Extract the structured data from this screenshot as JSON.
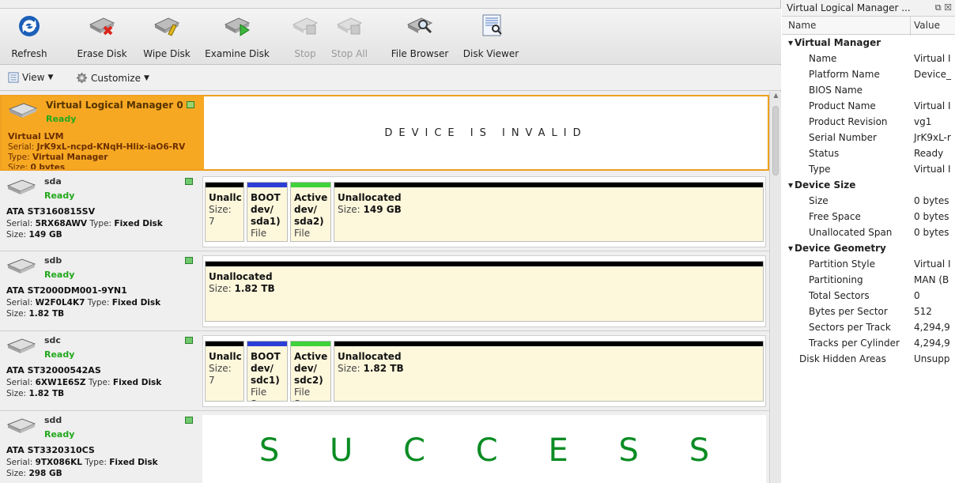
{
  "toolbar": {
    "buttons": [
      {
        "label": "Refresh",
        "enabled": true,
        "icon": "refresh-icon"
      },
      {
        "label": "Erase Disk",
        "enabled": true,
        "icon": "erase-disk-icon"
      },
      {
        "label": "Wipe Disk",
        "enabled": true,
        "icon": "wipe-disk-icon"
      },
      {
        "label": "Examine Disk",
        "enabled": true,
        "icon": "examine-disk-icon"
      },
      {
        "label": "Stop",
        "enabled": false,
        "icon": "stop-icon"
      },
      {
        "label": "Stop All",
        "enabled": false,
        "icon": "stop-all-icon"
      },
      {
        "label": "File Browser",
        "enabled": true,
        "icon": "file-browser-icon"
      },
      {
        "label": "Disk Viewer",
        "enabled": true,
        "icon": "disk-viewer-icon"
      }
    ]
  },
  "viewbar": {
    "view_label": "View",
    "customize_label": "Customize"
  },
  "disks": [
    {
      "name": "Virtual Logical Manager 0",
      "status": "Ready",
      "model": "Virtual LVM",
      "serial_label": "Serial:",
      "serial": "JrK9xL-ncpd-KNqH-Hlix-iaO6-RV",
      "type_label": "Type:",
      "type": "Virtual Manager",
      "size_label": "Size:",
      "size": "0 bytes",
      "message": "DEVICE IS INVALID"
    },
    {
      "name": "sda",
      "status": "Ready",
      "model": "ATA ST3160815SV",
      "serial_label": "Serial:",
      "serial": "5RX68AWV",
      "type_label": "Type:",
      "type": "Fixed Disk",
      "size_label": "Size:",
      "size": "149 GB",
      "partitions": [
        {
          "title": "Unallc",
          "sub": "Size: 7",
          "color": "#000000"
        },
        {
          "title": "BOOT",
          "l2": "dev/",
          "l3": "sda1)",
          "l4": "File Sys",
          "color": "#2c3ed6"
        },
        {
          "title": "Active",
          "l2": "dev/",
          "l3": "sda2)",
          "l4": "File Sys",
          "color": "#3fd23a"
        },
        {
          "title": "Unallocated",
          "sub_label": "Size:",
          "sub_value": "149 GB",
          "color": "#000000"
        }
      ]
    },
    {
      "name": "sdb",
      "status": "Ready",
      "model": "ATA ST2000DM001-9YN1",
      "serial_label": "Serial:",
      "serial": "W2F0L4K7",
      "type_label": "Type:",
      "type": "Fixed Disk",
      "size_label": "Size:",
      "size": "1.82 TB",
      "partitions": [
        {
          "title": "Unallocated",
          "sub_label": "Size:",
          "sub_value": "1.82 TB",
          "color": "#000000"
        }
      ]
    },
    {
      "name": "sdc",
      "status": "Ready",
      "model": "ATA ST32000542AS",
      "serial_label": "Serial:",
      "serial": "6XW1E6SZ",
      "type_label": "Type:",
      "type": "Fixed Disk",
      "size_label": "Size:",
      "size": "1.82 TB",
      "partitions": [
        {
          "title": "Unallc",
          "sub": "Size: 7",
          "color": "#000000"
        },
        {
          "title": "BOOT",
          "l2": "dev/",
          "l3": "sdc1)",
          "l4": "File Sys",
          "color": "#2c3ed6"
        },
        {
          "title": "Active",
          "l2": "dev/",
          "l3": "sdc2)",
          "l4": "File Sys",
          "color": "#3fd23a"
        },
        {
          "title": "Unallocated",
          "sub_label": "Size:",
          "sub_value": "1.82 TB",
          "color": "#000000"
        }
      ]
    },
    {
      "name": "sdd",
      "status": "Ready",
      "model": "ATA ST3320310CS",
      "serial_label": "Serial:",
      "serial": "9TX086KL",
      "type_label": "Type:",
      "type": "Fixed Disk",
      "size_label": "Size:",
      "size": "298 GB",
      "message_letters": [
        "S",
        "U",
        "C",
        "C",
        "E",
        "S",
        "S"
      ]
    }
  ],
  "properties": {
    "title": "Virtual Logical Manager ...",
    "col_name": "Name",
    "col_value": "Value",
    "rows": [
      {
        "group": true,
        "name": "Virtual Manager"
      },
      {
        "name": "Name",
        "value": "Virtual I"
      },
      {
        "name": "Platform Name",
        "value": "Device_"
      },
      {
        "name": "BIOS Name",
        "value": ""
      },
      {
        "name": "Product Name",
        "value": "Virtual I"
      },
      {
        "name": "Product Revision",
        "value": "vg1"
      },
      {
        "name": "Serial Number",
        "value": "JrK9xL-r"
      },
      {
        "name": "Status",
        "value": "Ready"
      },
      {
        "name": "Type",
        "value": "Virtual I"
      },
      {
        "group": true,
        "name": "Device Size"
      },
      {
        "name": "Size",
        "value": "0 bytes"
      },
      {
        "name": "Free Space",
        "value": "0 bytes"
      },
      {
        "name": "Unallocated Span",
        "value": "0 bytes"
      },
      {
        "group": true,
        "name": "Device Geometry"
      },
      {
        "name": "Partition Style",
        "value": "Virtual I"
      },
      {
        "name": "Partitioning",
        "value": "MAN (B"
      },
      {
        "name": "Total Sectors",
        "value": "0"
      },
      {
        "name": "Bytes per Sector",
        "value": "512"
      },
      {
        "name": "Sectors per Track",
        "value": "4,294,9"
      },
      {
        "name": "Tracks per Cylinder",
        "value": "4,294,9"
      },
      {
        "name": "Disk Hidden Areas",
        "value": "Unsupp",
        "top_level": true
      }
    ]
  }
}
